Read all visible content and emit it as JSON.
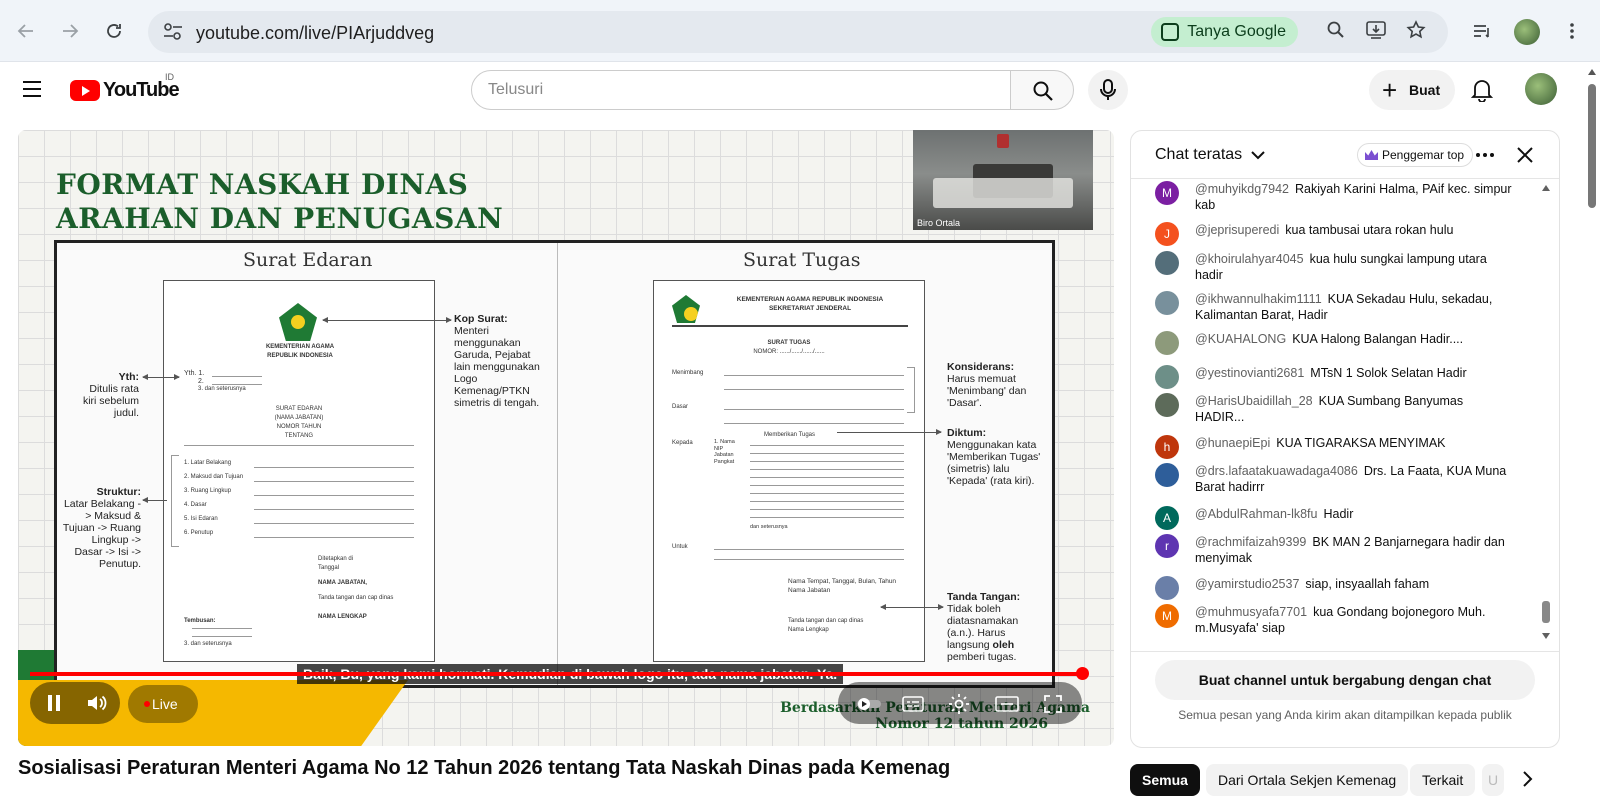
{
  "browser": {
    "url": "youtube.com/live/PIArjuddveg",
    "tanya_google": "Tanya Google"
  },
  "youtube": {
    "logo_text": "YouTube",
    "region": "ID",
    "search_placeholder": "Telusuri",
    "create_label": "Buat"
  },
  "slide": {
    "title_line1": "FORMAT NASKAH DINAS",
    "title_line2": "ARAHAN DAN PENUGASAN",
    "left_col_title": "Surat Edaran",
    "right_col_title": "Surat Tugas",
    "left_doc": {
      "header1": "KEMENTERIAN AGAMA",
      "header2": "REPUBLIK INDONESIA",
      "yth": "Yth. 1.",
      "yth2": "2.",
      "yth3": "3. dan seterusnya",
      "se_title1": "SURAT EDARAN",
      "se_title2": "(NAMA JABATAN)",
      "se_title3": "NOMOR       TAHUN",
      "se_title4": "TENTANG",
      "items": [
        "1. Latar Belakang",
        "2. Maksud dan Tujuan",
        "3. Ruang Lingkup",
        "4. Dasar",
        "5. Isi Edaran",
        "6. Penutup"
      ],
      "sign1": "Ditetapkan di",
      "sign2": "Tanggal",
      "sign3": "NAMA JABATAN,",
      "sign4": "Tanda tangan dan cap dinas",
      "sign5": "NAMA LENGKAP",
      "tembusan": "Tembusan:",
      "tembusan3": "3. dan seterusnya"
    },
    "right_doc": {
      "header1": "KEMENTERIAN AGAMA REPUBLIK INDONESIA",
      "header2": "SEKRETARIAT JENDERAL",
      "st_title": "SURAT TUGAS",
      "st_nomor": "NOMOR: ....../....../....../......",
      "menimbang": "Menimbang",
      "dasar": "Dasar",
      "kepada": "Kepada",
      "untuk": "Untuk",
      "memberikan": "Memberikan Tugas",
      "dan_seterusnya": "dan seterusnya",
      "nama_fields": [
        "1. Nama",
        "NIP",
        "Jabatan",
        "Pangkat"
      ],
      "place": "Nama Tempat, Tanggal, Bulan, Tahun",
      "place2": "Nama Jabatan",
      "sign1": "Tanda tangan dan cap dinas",
      "sign2": "Nama Lengkap"
    },
    "annotations": {
      "kop_title": "Kop Surat:",
      "kop_body": "Menteri menggunakan Garuda, Pejabat lain menggunakan Logo Kemenag/PTKN simetris di tengah.",
      "yth_title": "Yth:",
      "yth_body": "Ditulis rata kiri sebelum judul.",
      "struktur_title": "Struktur:",
      "struktur_body": "Latar Belakang -> Maksud & Tujuan -> Ruang Lingkup -> Dasar -> Isi -> Penutup.",
      "konsiderans_title": "Konsiderans:",
      "konsiderans_body": "Harus memuat 'Menimbang' dan 'Dasar'.",
      "diktum_title": "Diktum:",
      "diktum_body": "Menggunakan kata 'Memberikan Tugas' (simetris) lalu 'Kepada' (rata kiri).",
      "ttd_title": "Tanda Tangan:",
      "ttd_body_a": "Tidak boleh diatasnamakan (a.n.). Harus langsung ",
      "ttd_body_b": "oleh",
      "ttd_body_c": " pemberi tugas."
    },
    "camera_label": "Biro Ortala",
    "footer_line1": "Berdasarkan Peraturan Menteri Agama",
    "footer_line2": "Nomor 12 tahun 2026"
  },
  "player": {
    "caption": "Baik, Bu, yang kami hormati. Kemudian di bawah logo itu, ada nama jabatan. Ya.",
    "live_label": "Live",
    "progress_fraction": 1.0
  },
  "video_title": "Sosialisasi Peraturan Menteri Agama No 12 Tahun 2026 tentang Tata Naskah Dinas pada Kemenag",
  "chat": {
    "title": "Chat teratas",
    "fan_label": "Penggemar top",
    "messages": [
      {
        "author": "@muhyikdg7942",
        "text": "Rakiyah Karini Halma, PAif kec. simpur kab",
        "initial": "M",
        "color": "#7b1fa2"
      },
      {
        "author": "@jeprisuperedi",
        "text": "kua tambusai utara rokan hulu",
        "initial": "J",
        "color": "#f4511e"
      },
      {
        "author": "@khoirulahyar4045",
        "text": "kua hulu sungkai lampung utara hadir",
        "initial": "",
        "color": "#546e7a"
      },
      {
        "author": "@ikhwannulhakim1111",
        "text": "KUA Sekadau Hulu, sekadau, Kalimantan Barat, Hadir",
        "initial": "",
        "color": "#78909c"
      },
      {
        "author": "@KUAHALONG",
        "text": "KUA Halong Balangan Hadir....",
        "initial": "",
        "color": "#8d9a7b"
      },
      {
        "author": "@yestinovianti2681",
        "text": "MTsN 1 Solok Selatan Hadir",
        "initial": "",
        "color": "#6d8f88"
      },
      {
        "author": "@HarisUbaidillah_28",
        "text": "KUA Sumbang Banyumas HADIR...",
        "initial": "",
        "color": "#5d6b5a"
      },
      {
        "author": "@hunaepiEpi",
        "text": "KUA TIGARAKSA MENYIMAK",
        "initial": "h",
        "color": "#bf360c"
      },
      {
        "author": "@drs.lafaatakuawadaga4086",
        "text": "Drs. La Faata, KUA Muna Barat hadirrr",
        "initial": "",
        "color": "#2e5e9a"
      },
      {
        "author": "@AbdulRahman-lk8fu",
        "text": "Hadir",
        "initial": "A",
        "color": "#00695c"
      },
      {
        "author": "@rachmifaizah9399",
        "text": "BK MAN 2 Banjarnegara hadir dan menyimak",
        "initial": "r",
        "color": "#5e35b1"
      },
      {
        "author": "@yamirstudio2537",
        "text": "siap, insyaallah faham",
        "initial": "",
        "color": "#6a7fa8"
      },
      {
        "author": "@muhmusyafa7701",
        "text": "kua Gondang bojonegoro Muh. m.Musyafa' siap",
        "initial": "M",
        "color": "#ef6c00"
      }
    ],
    "join_button": "Buat channel untuk bergabung dengan chat",
    "footer_note": "Semua pesan yang Anda kirim akan ditampilkan kepada publik"
  },
  "chips": [
    "Semua",
    "Dari Ortala Sekjen Kemenag",
    "Terkait",
    "U"
  ]
}
